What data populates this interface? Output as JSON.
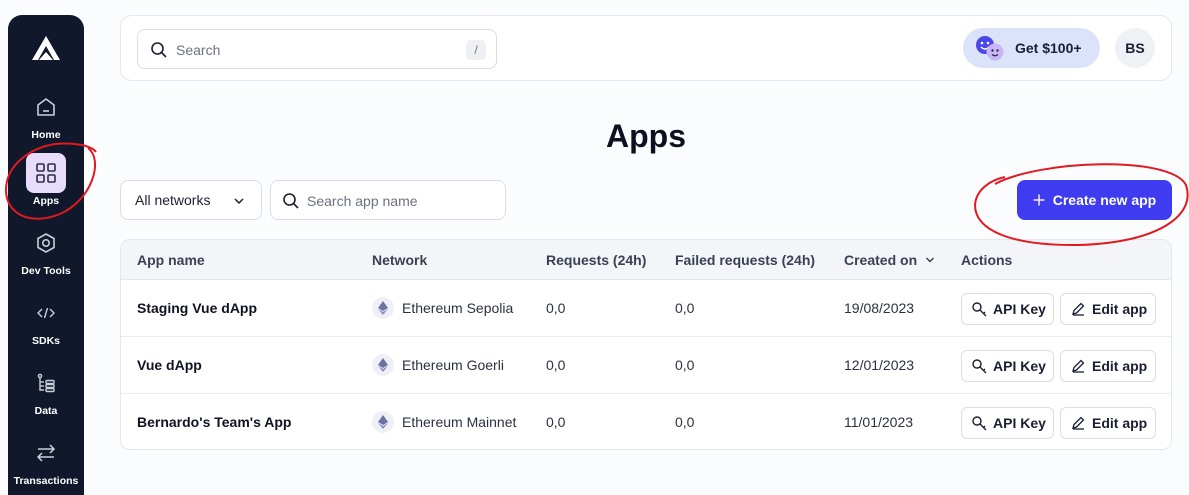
{
  "sidebar": {
    "items": [
      {
        "label": "Home",
        "icon": "home-icon"
      },
      {
        "label": "Apps",
        "icon": "apps-grid-icon",
        "active": true
      },
      {
        "label": "Dev Tools",
        "icon": "dev-tools-icon"
      },
      {
        "label": "SDKs",
        "icon": "code-icon"
      },
      {
        "label": "Data",
        "icon": "data-icon"
      },
      {
        "label": "Transactions",
        "icon": "transactions-icon"
      }
    ]
  },
  "header": {
    "search_placeholder": "Search",
    "search_shortcut": "/",
    "promo_label": "Get $100+",
    "avatar_initials": "BS"
  },
  "page": {
    "title": "Apps",
    "network_filter": "All networks",
    "app_search_placeholder": "Search app name",
    "create_button": "Create new app"
  },
  "table": {
    "columns": [
      "App name",
      "Network",
      "Requests (24h)",
      "Failed requests (24h)",
      "Created on",
      "Actions"
    ],
    "rows": [
      {
        "name": "Staging Vue dApp",
        "network": "Ethereum Sepolia",
        "requests": "0,0",
        "failed": "0,0",
        "created": "19/08/2023"
      },
      {
        "name": "Vue dApp",
        "network": "Ethereum Goerli",
        "requests": "0,0",
        "failed": "0,0",
        "created": "12/01/2023"
      },
      {
        "name": "Bernardo's Team's App",
        "network": "Ethereum Mainnet",
        "requests": "0,0",
        "failed": "0,0",
        "created": "11/01/2023"
      }
    ],
    "api_key_label": "API Key",
    "edit_app_label": "Edit app"
  },
  "colors": {
    "sidebar_bg": "#11182b",
    "accent": "#3e3bf1",
    "annotation": "#e0191f"
  }
}
